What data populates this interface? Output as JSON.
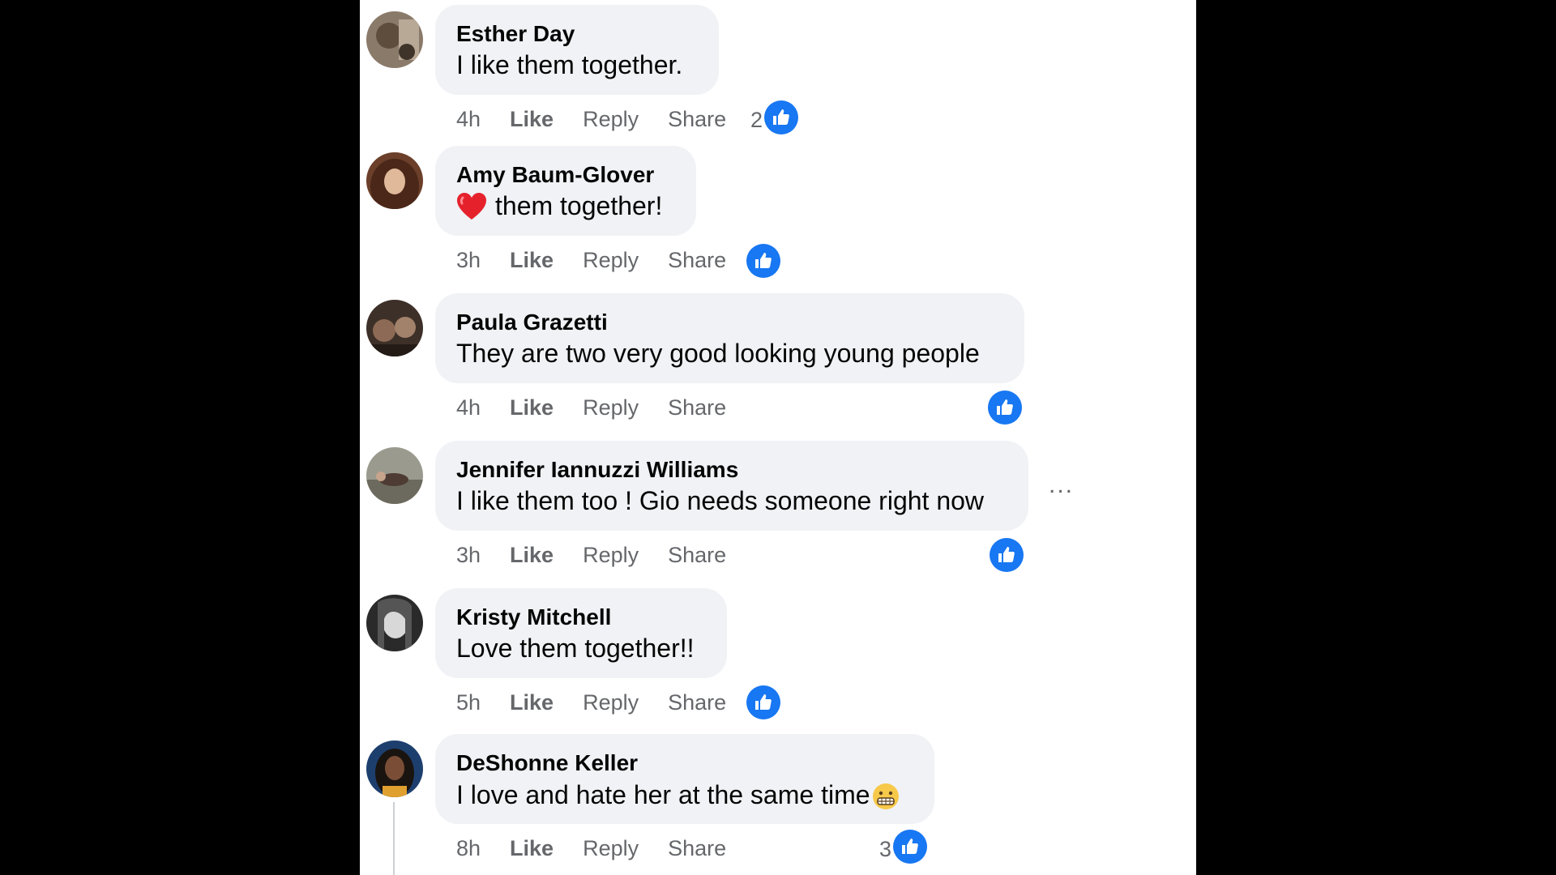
{
  "comments": [
    {
      "name": "Esther Day",
      "text": "I like them together.",
      "time": "4h",
      "like": "Like",
      "reply": "Reply",
      "share": "Share",
      "reaction_count": "2"
    },
    {
      "name": "Amy Baum-Glover",
      "text": "them together!",
      "emoji": "red-heart",
      "time": "3h",
      "like": "Like",
      "reply": "Reply",
      "share": "Share",
      "reaction_count": ""
    },
    {
      "name": "Paula Grazetti",
      "text": "They are two very good looking young people",
      "time": "4h",
      "like": "Like",
      "reply": "Reply",
      "share": "Share",
      "reaction_count": ""
    },
    {
      "name": "Jennifer Iannuzzi Williams",
      "text": "I like them too ! Gio needs someone right now",
      "time": "3h",
      "like": "Like",
      "reply": "Reply",
      "share": "Share",
      "reaction_count": ""
    },
    {
      "name": "Kristy Mitchell",
      "text": "Love them together!!",
      "time": "5h",
      "like": "Like",
      "reply": "Reply",
      "share": "Share",
      "reaction_count": ""
    },
    {
      "name": "DeShonne Keller",
      "text": "I love and hate her at the same time",
      "emoji": "grimacing-face",
      "time": "8h",
      "like": "Like",
      "reply": "Reply",
      "share": "Share",
      "reaction_count": "3"
    }
  ],
  "more_options": "...",
  "colors": {
    "like_blue": "#1877f2",
    "bubble": "#f0f2f5",
    "meta_text": "#65676b"
  }
}
